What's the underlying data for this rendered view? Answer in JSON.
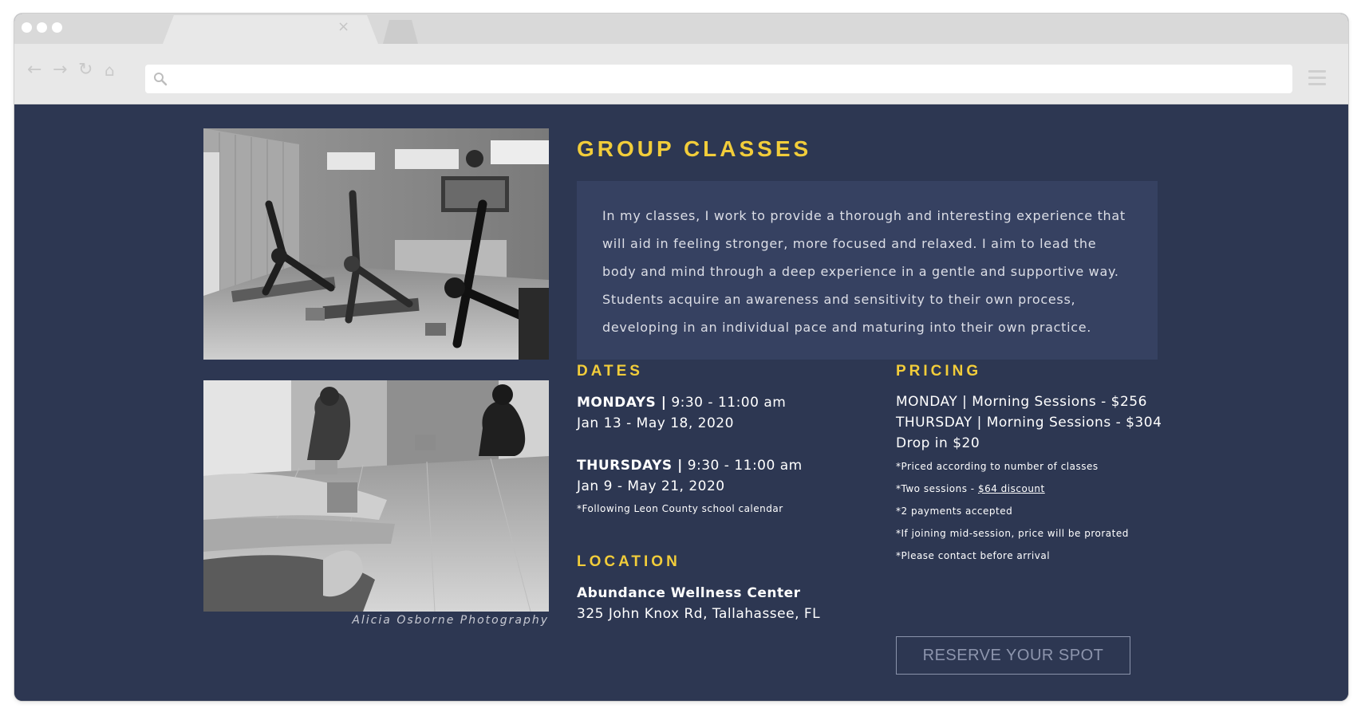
{
  "browser": {
    "url": "",
    "tab_close": "×",
    "nav_icons": [
      "back-icon",
      "forward-icon",
      "reload-icon",
      "home-icon"
    ]
  },
  "colors": {
    "page_bg": "#2d3752",
    "panel_bg": "#364161",
    "accent": "#f2cd3a",
    "text": "#ffffff",
    "button_text": "#8d95ad"
  },
  "photos": {
    "credit": "Alicia Osborne Photography"
  },
  "heading": "GROUP CLASSES",
  "intro": "In my classes, I work to provide a thorough and interesting experience that will aid in feeling stronger, more focused and relaxed. I aim to lead the body and mind through a deep experience in a gentle and supportive way. Students acquire an awareness and sensitivity to their own process, developing in an individual pace and maturing into their own practice.",
  "dates": {
    "heading": "DATES",
    "monday_day": "MONDAYS |",
    "monday_time": " 9:30 - 11:00 am",
    "monday_range": "Jan 13 - May 18, 2020",
    "thursday_day": "THURSDAYS |",
    "thursday_time": " 9:30 - 11:00 am",
    "thursday_range": "Jan 9 - May 21, 2020",
    "note": "*Following Leon County school calendar"
  },
  "location": {
    "heading": "LOCATION",
    "name": "Abundance Wellness Center",
    "address": "325 John Knox Rd, Tallahassee, FL"
  },
  "pricing": {
    "heading": "PRICING",
    "line1": "MONDAY | Morning Sessions - $256",
    "line2": "THURSDAY | Morning Sessions - $304",
    "line3": "Drop in $20",
    "note1": "*Priced according to number of classes",
    "note2_prefix": "*Two sessions - ",
    "note2_link": "$64 discount",
    "note3": "*2 payments accepted",
    "note4": "*If joining mid-session, price will be prorated",
    "note5": "*Please contact before arrival"
  },
  "cta": {
    "label": "RESERVE YOUR SPOT"
  }
}
